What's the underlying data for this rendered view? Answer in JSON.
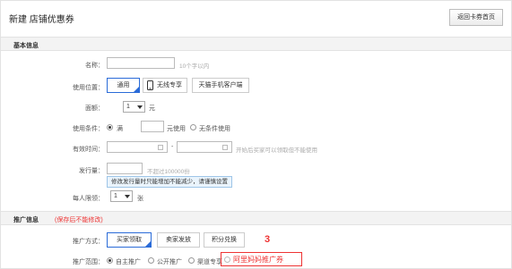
{
  "header": {
    "title": "新建 店铺优惠券",
    "back_button": "返回卡券首页"
  },
  "basic": {
    "section_title": "基本信息",
    "name": {
      "label": "名称：",
      "value": "",
      "hint": "10个字以内"
    },
    "usage_location": {
      "label": "使用位置：",
      "options": [
        "通用",
        "无线专享",
        "天猫手机客户端"
      ],
      "selected": "通用",
      "icon": "phone-icon"
    },
    "denomination": {
      "label": "面额：",
      "value": "1",
      "unit": "元"
    },
    "conditions": {
      "label": "使用条件：",
      "option_full": "满",
      "full_suffix": "元使用",
      "option_none": "无条件使用"
    },
    "validity": {
      "label": "有效时间：",
      "separator": "-",
      "hint": "开始后买家可以领取但不能使用"
    },
    "quantity": {
      "label": "发行量：",
      "hint": "不超过100000份",
      "tip": "修改发行量时只能增加不能减少，请谨慎设置"
    },
    "per_person": {
      "label": "每人限领：",
      "value": "1",
      "unit": "张"
    }
  },
  "promo": {
    "section_title": "推广信息",
    "section_note": "(保存后不能修改)",
    "method": {
      "label": "推广方式：",
      "options": [
        "买家领取",
        "卖家发放",
        "积分兑换"
      ],
      "selected": "买家领取"
    },
    "scope": {
      "label": "推广范围：",
      "options": [
        "自主推广",
        "公开推广",
        "渠道专享",
        "阿里妈妈推广券"
      ],
      "selected": "自主推广"
    }
  },
  "annotation": {
    "number": "3",
    "color": "#e33333"
  }
}
